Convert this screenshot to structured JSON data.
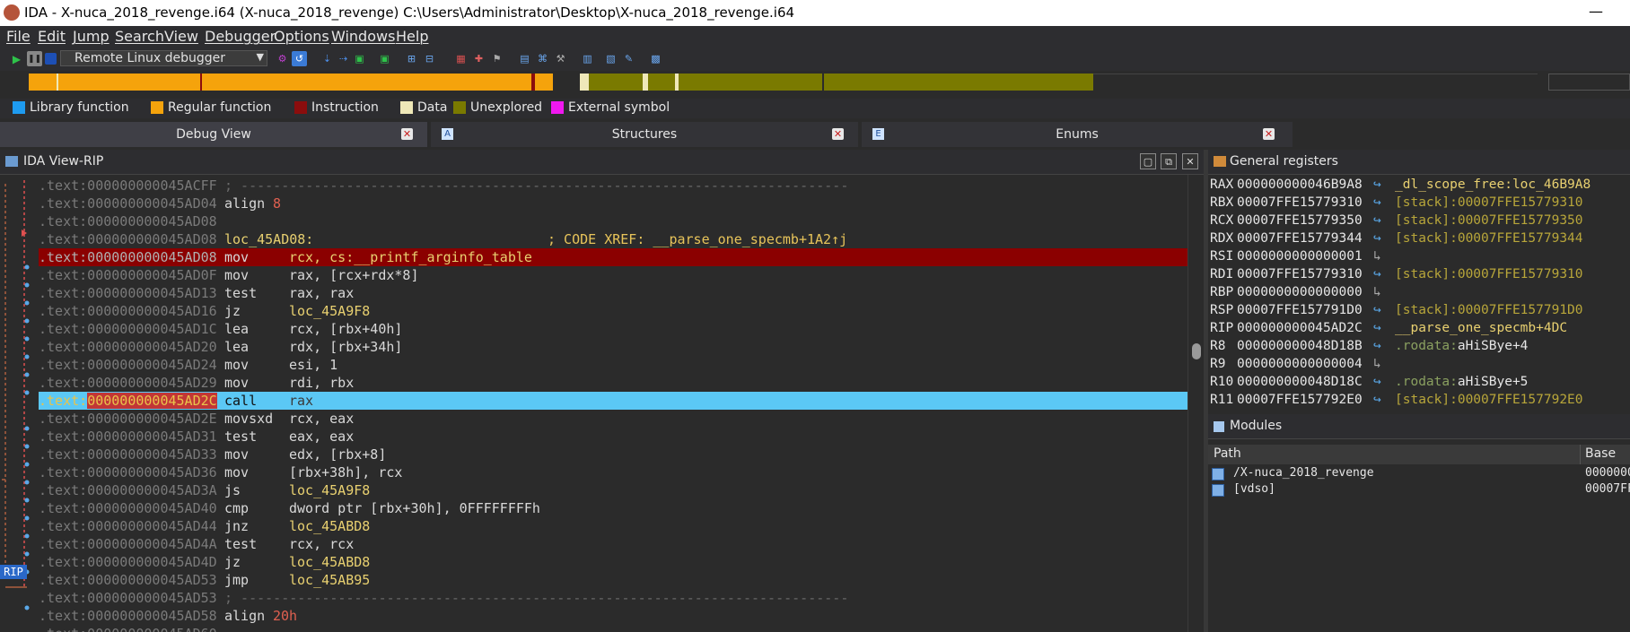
{
  "titlebar": {
    "title": "IDA - X-nuca_2018_revenge.i64 (X-nuca_2018_revenge) C:\\Users\\Administrator\\Desktop\\X-nuca_2018_revenge.i64",
    "minimize": "—"
  },
  "menu": [
    "File",
    "Edit",
    "Jump",
    "Search",
    "View",
    "Debugger",
    "Options",
    "Windows",
    "Help"
  ],
  "toolbar": {
    "debugger_select": "Remote Linux debugger"
  },
  "legend": [
    {
      "label": "Library function",
      "color": "#1e9bf0"
    },
    {
      "label": "Regular function",
      "color": "#f5a30c"
    },
    {
      "label": "Instruction",
      "color": "#8b0d0d"
    },
    {
      "label": "Data",
      "color": "#efe8b8"
    },
    {
      "label": "Unexplored",
      "color": "#7a7a00"
    },
    {
      "label": "External symbol",
      "color": "#f018f0"
    }
  ],
  "tabs": [
    {
      "label": "Debug View",
      "close": "✕"
    },
    {
      "label": "Structures",
      "close": "✕",
      "icon": "A"
    },
    {
      "label": "Enums",
      "close": "✕",
      "icon": "E"
    }
  ],
  "ida_view": {
    "title": "IDA View-RIP",
    "rip_marker": "RIP",
    "lines": [
      {
        "addr": ".text:000000000045ACFF",
        "sep": "; ---------------------------------------------------------------------------",
        "type": "sep"
      },
      {
        "addr": ".text:000000000045AD04",
        "mnem": "align",
        "op": "8",
        "type": "align"
      },
      {
        "addr": ".text:000000000045AD08",
        "type": "blank"
      },
      {
        "addr": ".text:000000000045AD08",
        "label": "loc_45AD08:",
        "comment": "; CODE XREF: __parse_one_specmb+1A2↑j",
        "type": "label"
      },
      {
        "addr": ".text:000000000045AD08",
        "mnem": "mov",
        "op": "rcx, cs:__printf_arginfo_table",
        "type": "bp"
      },
      {
        "addr": ".text:000000000045AD0F",
        "mnem": "mov",
        "op": "rax, [rcx+rdx*8]"
      },
      {
        "addr": ".text:000000000045AD13",
        "mnem": "test",
        "op": "rax, rax"
      },
      {
        "addr": ".text:000000000045AD16",
        "mnem": "jz",
        "op": "loc_45A9F8"
      },
      {
        "addr": ".text:000000000045AD1C",
        "mnem": "lea",
        "op": "rcx, [rbx+40h]"
      },
      {
        "addr": ".text:000000000045AD20",
        "mnem": "lea",
        "op": "rdx, [rbx+34h]"
      },
      {
        "addr": ".text:000000000045AD24",
        "mnem": "mov",
        "op": "esi, 1"
      },
      {
        "addr": ".text:000000000045AD29",
        "mnem": "mov",
        "op": "rdi, rbx"
      },
      {
        "addr_prefix": ".text:",
        "addr_hex": "000000000045AD2C",
        "mnem": "call",
        "op": "rax",
        "type": "cur"
      },
      {
        "addr": ".text:000000000045AD2E",
        "mnem": "movsxd",
        "op": "rcx, eax"
      },
      {
        "addr": ".text:000000000045AD31",
        "mnem": "test",
        "op": "eax, eax"
      },
      {
        "addr": ".text:000000000045AD33",
        "mnem": "mov",
        "op": "edx, [rbx+8]"
      },
      {
        "addr": ".text:000000000045AD36",
        "mnem": "mov",
        "op": "[rbx+38h], rcx"
      },
      {
        "addr": ".text:000000000045AD3A",
        "mnem": "js",
        "op": "loc_45A9F8"
      },
      {
        "addr": ".text:000000000045AD40",
        "mnem": "cmp",
        "op": "dword ptr [rbx+30h], 0FFFFFFFFh"
      },
      {
        "addr": ".text:000000000045AD44",
        "mnem": "jnz",
        "op": "loc_45ABD8"
      },
      {
        "addr": ".text:000000000045AD4A",
        "mnem": "test",
        "op": "rcx, rcx"
      },
      {
        "addr": ".text:000000000045AD4D",
        "mnem": "jz",
        "op": "loc_45ABD8"
      },
      {
        "addr": ".text:000000000045AD53",
        "mnem": "jmp",
        "op": "loc_45AB95"
      },
      {
        "addr": ".text:000000000045AD53",
        "sep": "; ---------------------------------------------------------------------------",
        "type": "sep"
      },
      {
        "addr": ".text:000000000045AD58",
        "mnem": "align",
        "op": "20h",
        "type": "align"
      },
      {
        "addr": ".text:000000000045AD60",
        "type": "blank"
      }
    ]
  },
  "registers": {
    "title": "General registers",
    "rows": [
      {
        "name": "RAX",
        "value": "000000000046B9A8",
        "arrow": "↪",
        "desc": "_dl_scope_free:loc_46B9A8"
      },
      {
        "name": "RBX",
        "value": "00007FFE15779310",
        "arrow": "↪",
        "desc": "[stack]:00007FFE15779310"
      },
      {
        "name": "RCX",
        "value": "00007FFE15779350",
        "arrow": "↪",
        "desc": "[stack]:00007FFE15779350"
      },
      {
        "name": "RDX",
        "value": "00007FFE15779344",
        "arrow": "↪",
        "desc": "[stack]:00007FFE15779344"
      },
      {
        "name": "RSI",
        "value": "0000000000000001",
        "arrow": "↳",
        "desc": ""
      },
      {
        "name": "RDI",
        "value": "00007FFE15779310",
        "arrow": "↪",
        "desc": "[stack]:00007FFE15779310"
      },
      {
        "name": "RBP",
        "value": "0000000000000000",
        "arrow": "↳",
        "desc": ""
      },
      {
        "name": "RSP",
        "value": "00007FFE157791D0",
        "arrow": "↪",
        "desc": "[stack]:00007FFE157791D0"
      },
      {
        "name": "RIP",
        "value": "000000000045AD2C",
        "arrow": "↪",
        "desc": "__parse_one_specmb+4DC"
      },
      {
        "name": "R8",
        "value": "000000000048D18B",
        "arrow": "↪",
        "desc_dim": ".rodata:",
        "desc": "aHiSBye+4"
      },
      {
        "name": "R9",
        "value": "0000000000000004",
        "arrow": "↳",
        "desc": ""
      },
      {
        "name": "R10",
        "value": "000000000048D18C",
        "arrow": "↪",
        "desc_dim": ".rodata:",
        "desc": "aHiSBye+5"
      },
      {
        "name": "R11",
        "value": "00007FFE157792E0",
        "arrow": "↪",
        "desc": "[stack]:00007FFE157792E0"
      }
    ]
  },
  "modules": {
    "title": "Modules",
    "columns": [
      "Path",
      "Base"
    ],
    "rows": [
      {
        "path": "/X-nuca_2018_revenge",
        "base": "0000000"
      },
      {
        "path": "[vdso]",
        "base": "00007FF"
      }
    ]
  }
}
